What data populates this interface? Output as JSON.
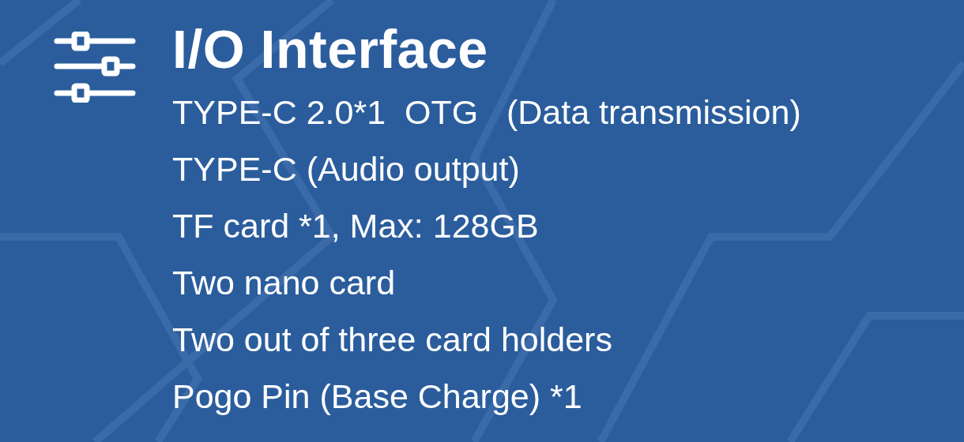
{
  "title": "I/O Interface",
  "items": [
    "TYPE-C 2.0*1  OTG   (Data transmission)",
    "TYPE-C (Audio output)",
    "TF card *1, Max: 128GB",
    "Two nano card",
    "Two out of three card holders",
    "Pogo Pin (Base Charge) *1"
  ]
}
